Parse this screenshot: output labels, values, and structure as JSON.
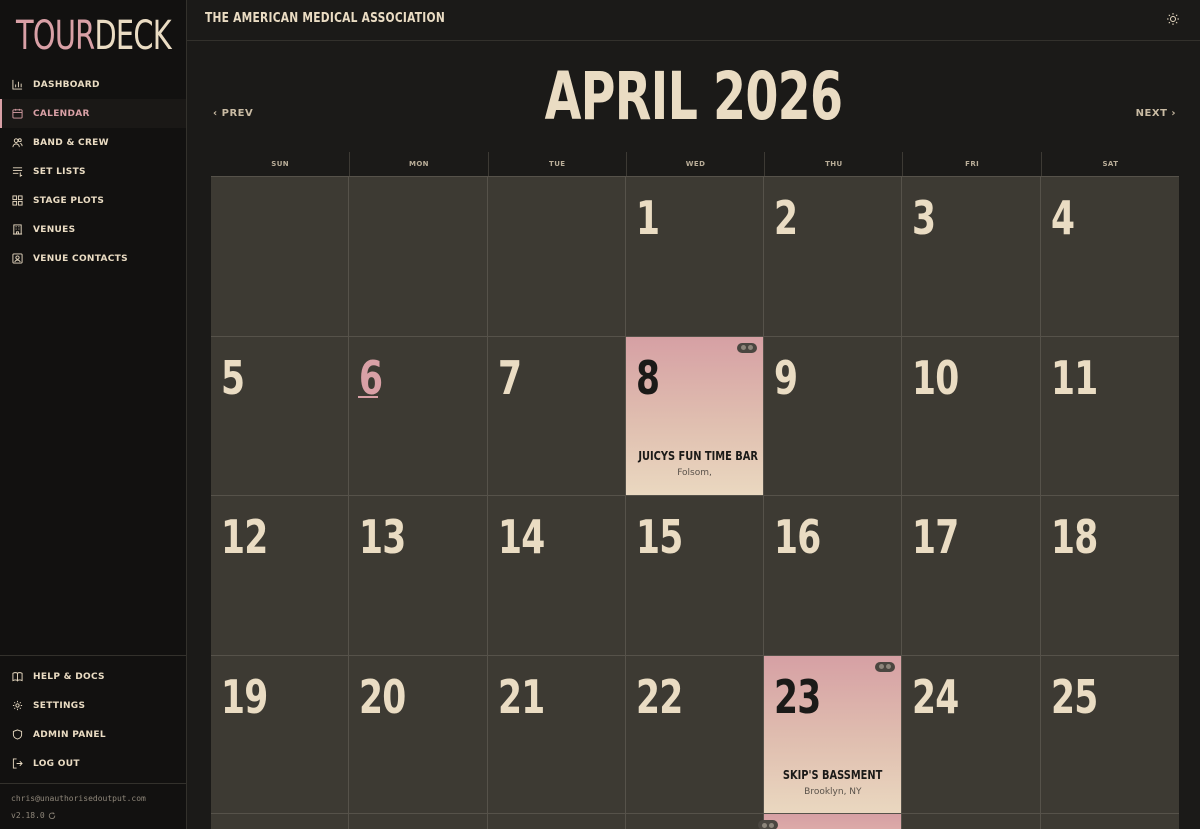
{
  "app": {
    "logo_part1": "TOUR",
    "logo_part2": "DECK",
    "band_name": "THE AMERICAN MEDICAL ASSOCIATION"
  },
  "sidebar": {
    "items": [
      {
        "label": "DASHBOARD",
        "icon": "chart-icon"
      },
      {
        "label": "CALENDAR",
        "icon": "calendar-icon",
        "active": true
      },
      {
        "label": "BAND & CREW",
        "icon": "users-icon"
      },
      {
        "label": "SET LISTS",
        "icon": "list-icon"
      },
      {
        "label": "STAGE PLOTS",
        "icon": "grid-icon"
      },
      {
        "label": "VENUES",
        "icon": "building-icon"
      },
      {
        "label": "VENUE CONTACTS",
        "icon": "contact-icon"
      }
    ],
    "bottom_items": [
      {
        "label": "HELP & DOCS",
        "icon": "book-icon"
      },
      {
        "label": "SETTINGS",
        "icon": "gear-icon"
      },
      {
        "label": "ADMIN PANEL",
        "icon": "shield-icon"
      },
      {
        "label": "LOG OUT",
        "icon": "logout-icon"
      }
    ],
    "user_email": "chris@unauthorisedoutput.com",
    "version": "v2.18.0"
  },
  "calendar": {
    "month_title": "APRIL 2026",
    "prev_label": "PREV",
    "next_label": "NEXT",
    "weekdays": [
      "SUN",
      "MON",
      "TUE",
      "WED",
      "THU",
      "FRI",
      "SAT"
    ],
    "today": "6",
    "weeks": [
      [
        "",
        "",
        "",
        "1",
        "2",
        "3",
        "4"
      ],
      [
        "5",
        "6",
        "7",
        "8",
        "9",
        "10",
        "11"
      ],
      [
        "12",
        "13",
        "14",
        "15",
        "16",
        "17",
        "18"
      ],
      [
        "19",
        "20",
        "21",
        "22",
        "23",
        "24",
        "25"
      ]
    ],
    "gigs": {
      "8": {
        "venue": "JUICYS FUN TIME BAR",
        "city": "Folsom,"
      },
      "23": {
        "venue": "SKIP'S BASSMENT",
        "city": "Brooklyn, NY"
      }
    }
  },
  "colors": {
    "accent": "#d9a0a6",
    "cream": "#eadcc3",
    "cell_bg": "#3d3a33",
    "sidebar_bg": "#121110"
  }
}
